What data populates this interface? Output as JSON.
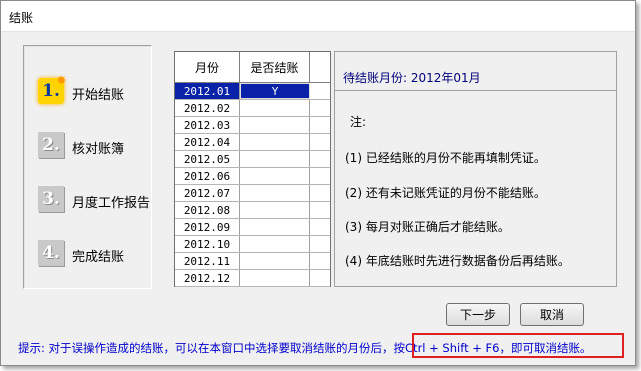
{
  "window": {
    "title": "结账"
  },
  "steps": [
    {
      "num": "1.",
      "label": "开始结账",
      "active": true
    },
    {
      "num": "2.",
      "label": "核对账簿",
      "active": false
    },
    {
      "num": "3.",
      "label": "月度工作报告",
      "active": false
    },
    {
      "num": "4.",
      "label": "完成结账",
      "active": false
    }
  ],
  "grid": {
    "headers": [
      "月份",
      "是否结账"
    ],
    "rows": [
      {
        "month": "2012.01",
        "closed": "Y",
        "selected": true
      },
      {
        "month": "2012.02",
        "closed": ""
      },
      {
        "month": "2012.03",
        "closed": ""
      },
      {
        "month": "2012.04",
        "closed": ""
      },
      {
        "month": "2012.05",
        "closed": ""
      },
      {
        "month": "2012.06",
        "closed": ""
      },
      {
        "month": "2012.07",
        "closed": ""
      },
      {
        "month": "2012.08",
        "closed": ""
      },
      {
        "month": "2012.09",
        "closed": ""
      },
      {
        "month": "2012.10",
        "closed": ""
      },
      {
        "month": "2012.11",
        "closed": ""
      },
      {
        "month": "2012.12",
        "closed": ""
      }
    ]
  },
  "info": {
    "title": "待结账月份: 2012年01月",
    "note_title": "注:",
    "notes": [
      "(1) 已经结账的月份不能再填制凭证。",
      "(2) 还有未记账凭证的月份不能结账。",
      "(3) 每月对账正确后才能结账。",
      "(4) 年底结账时先进行数据备份后再结账。"
    ]
  },
  "buttons": {
    "next": "下一步",
    "cancel": "取消"
  },
  "hint": "提示: 对于误操作造成的结账，可以在本窗口中选择要取消结账的月份后，按Ctrl + Shift + F6，即可取消结账。"
}
